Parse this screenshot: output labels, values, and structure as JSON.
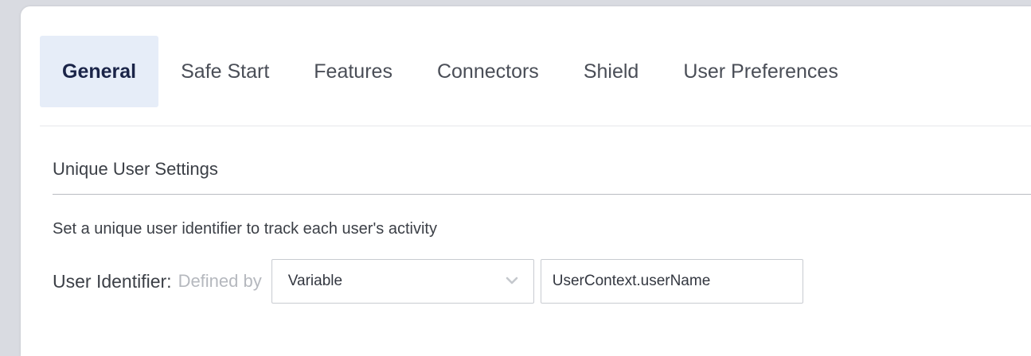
{
  "tabs": [
    {
      "label": "General",
      "active": true
    },
    {
      "label": "Safe Start",
      "active": false
    },
    {
      "label": "Features",
      "active": false
    },
    {
      "label": "Connectors",
      "active": false
    },
    {
      "label": "Shield",
      "active": false
    },
    {
      "label": "User Preferences",
      "active": false
    }
  ],
  "section": {
    "title": "Unique User Settings",
    "description": "Set a unique user identifier to track each user's activity"
  },
  "user_identifier": {
    "label": "User Identifier:",
    "hint": "Defined by",
    "select_value": "Variable",
    "input_value": "UserContext.userName"
  },
  "colors": {
    "active_tab_bg": "#e6edf8",
    "active_tab_text": "#1a2448",
    "hint_text": "#b5b8be"
  },
  "icons": {
    "select_arrow": "chevron-down-icon"
  }
}
